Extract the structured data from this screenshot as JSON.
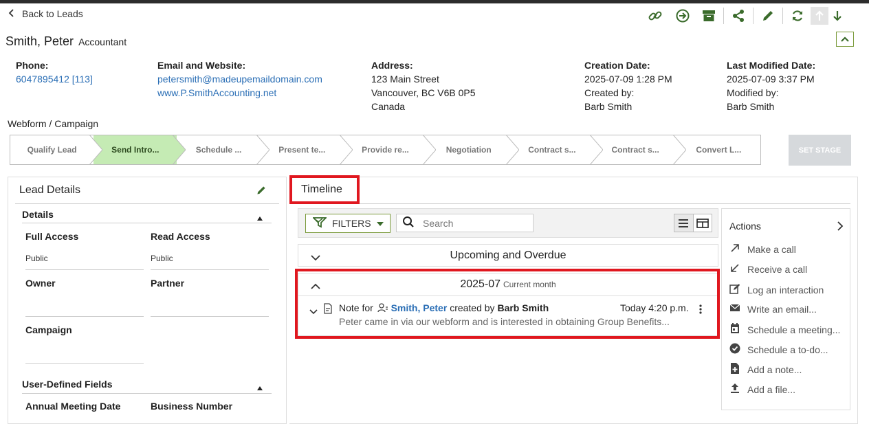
{
  "nav": {
    "back_label": "Back to Leads"
  },
  "contact": {
    "name": "Smith, Peter",
    "title": "Accountant"
  },
  "fields": {
    "phone_label": "Phone:",
    "phone": "6047895412 [113]",
    "email_label": "Email and Website:",
    "email": "petersmith@madeupemaildomain.com",
    "website": "www.P.SmithAccounting.net",
    "address_label": "Address:",
    "address1": "123 Main Street",
    "address2": "Vancouver, BC V6B 0P5",
    "address3": "Canada",
    "created_label": "Creation Date:",
    "created_date": "2025-07-09 1:28 PM",
    "created_by_label": "Created by:",
    "created_by": "Barb Smith",
    "modified_label": "Last Modified Date:",
    "modified_date": "2025-07-09 3:37 PM",
    "modified_by_label": "Modified by:",
    "modified_by": "Barb Smith"
  },
  "pipeline": {
    "name": "Webform / Campaign",
    "stages": [
      "Qualify Lead",
      "Send Intro...",
      "Schedule ...",
      "Present te...",
      "Provide re...",
      "Negotiation",
      "Contract s...",
      "Contract s...",
      "Convert L..."
    ],
    "active_index": 1,
    "set_stage_label": "SET STAGE"
  },
  "lead_details": {
    "title": "Lead Details",
    "details_heading": "Details",
    "full_access_label": "Full Access",
    "full_access": "Public",
    "read_access_label": "Read Access",
    "read_access": "Public",
    "owner_label": "Owner",
    "partner_label": "Partner",
    "campaign_label": "Campaign",
    "udf_heading": "User-Defined Fields",
    "annual_meeting_label": "Annual Meeting Date",
    "business_number_label": "Business Number"
  },
  "timeline": {
    "tab_label": "Timeline",
    "filters_label": "FILTERS",
    "search_placeholder": "Search",
    "upcoming_label": "Upcoming and Overdue",
    "month_label": "2025-07",
    "month_sub": "Current month",
    "note": {
      "prefix": "Note for",
      "contact": "Smith, Peter",
      "created_by_text": "created by",
      "author": "Barb Smith",
      "time": "Today 4:20 p.m.",
      "preview": "Peter came in via our webform and is interested in obtaining Group Benefits..."
    }
  },
  "actions": {
    "title": "Actions",
    "items": [
      "Make a call",
      "Receive a call",
      "Log an interaction",
      "Write an email...",
      "Schedule a meeting...",
      "Schedule a to-do...",
      "Add a note...",
      "Add a file..."
    ]
  },
  "colors": {
    "accent": "#3a6b2b",
    "active_stage": "#c5ebb4",
    "link": "#2a6eb5",
    "highlight": "#e0171f"
  }
}
